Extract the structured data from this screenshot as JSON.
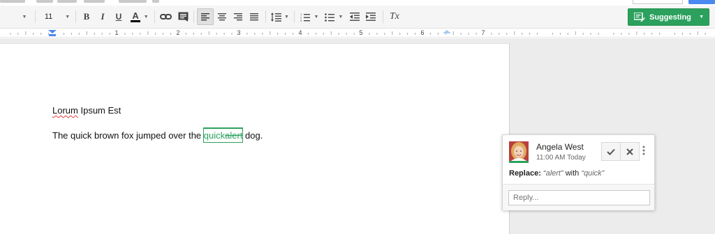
{
  "toolbar": {
    "font_size": "11",
    "bold": "B",
    "italic": "I",
    "underline": "U",
    "text_color": "A",
    "clear_format": "Tx",
    "suggesting_label": "Suggesting",
    "suggesting_color": "#2ba15d"
  },
  "ruler": {
    "numbers": [
      "1",
      "2",
      "3",
      "4",
      "5",
      "6",
      "7"
    ]
  },
  "document": {
    "title_word1": "Lorum",
    "title_rest": " Ipsum Est",
    "sentence_before": "The quick brown fox jumped over the ",
    "inserted": "quick",
    "deleted": "alert",
    "sentence_after": " dog."
  },
  "suggestion_card": {
    "author": "Angela West",
    "time": "11:00 AM Today",
    "replace_label": "Replace:",
    "old_text": "“alert”",
    "with_word": " with ",
    "new_text": "“quick”",
    "reply_placeholder": "Reply..."
  }
}
